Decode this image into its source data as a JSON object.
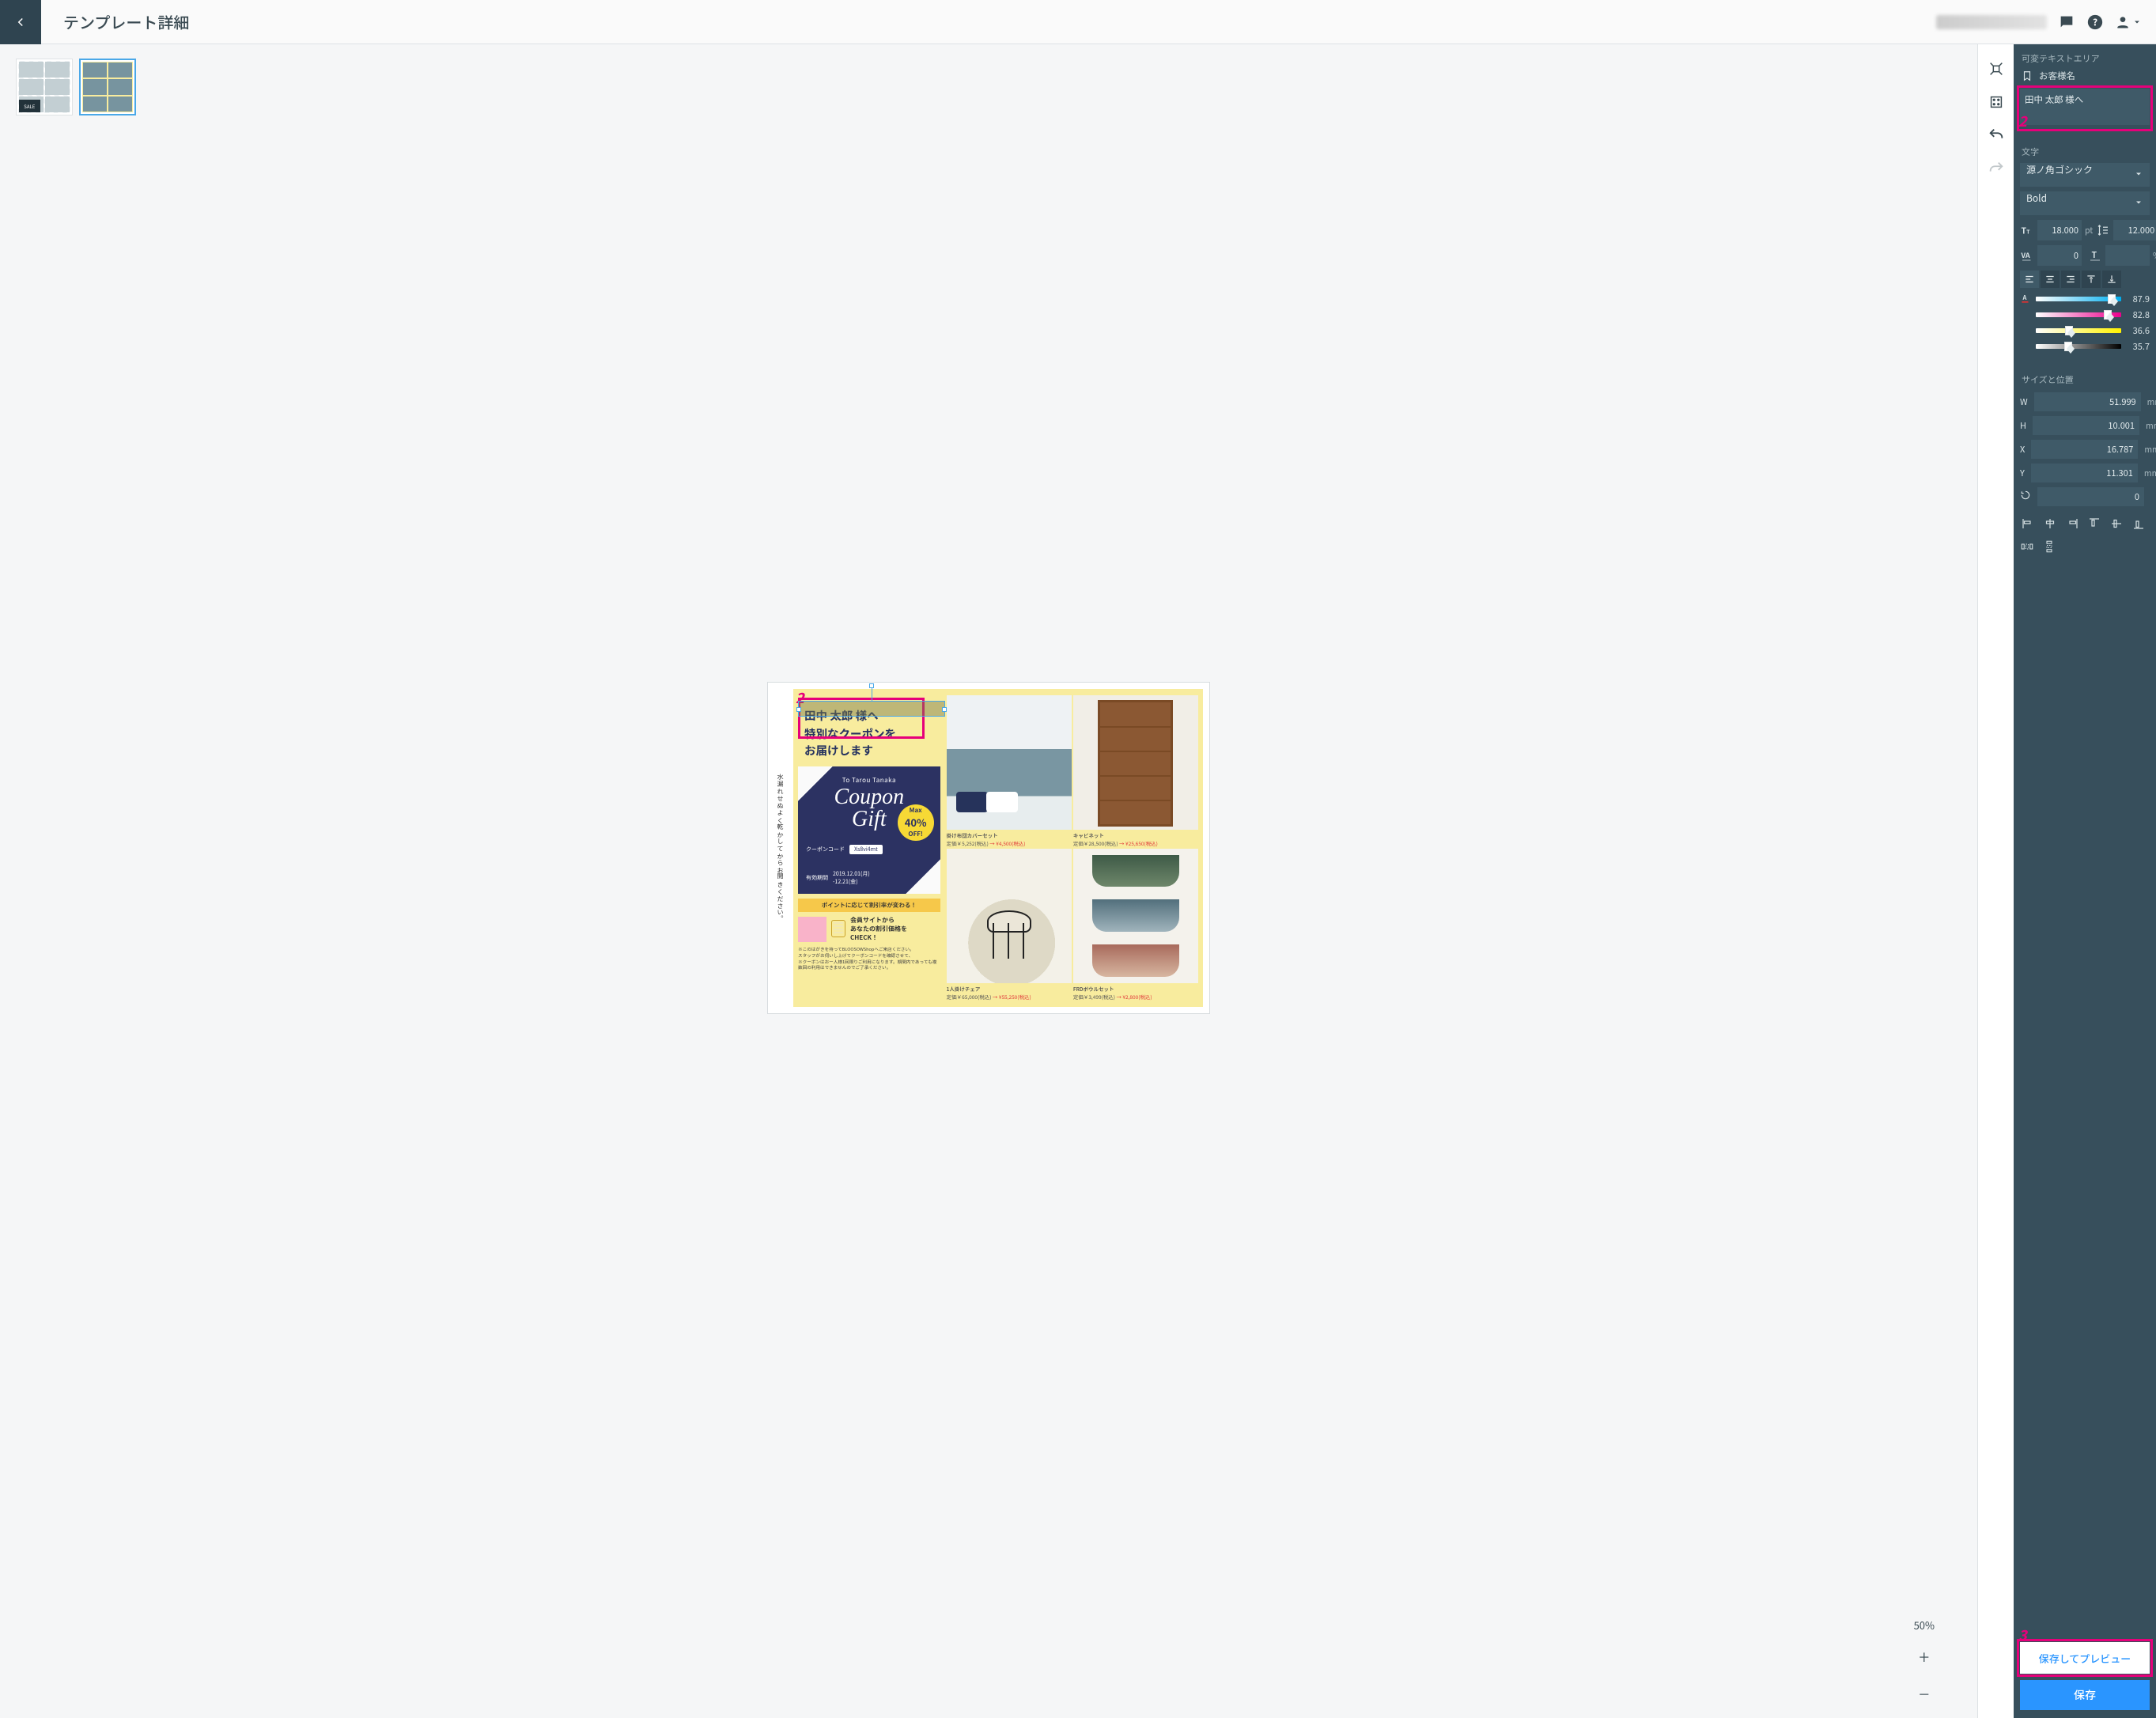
{
  "header": {
    "title": "テンプレート詳細"
  },
  "thumbs": {
    "sale_badge": "SALE"
  },
  "zoom": {
    "level": "50%"
  },
  "annotations": {
    "canvas_sel": "2",
    "panel_textarea": "2",
    "panel_preview": "3"
  },
  "canvas": {
    "vertical_note": "水漏れせぬよく乾かしてからお開きください。",
    "selected_text": "田中 太郎 様へ",
    "line2": "特別なクーポンを",
    "line3": "お届けします",
    "coupon": {
      "to": "To Tarou Tanaka",
      "big1": "Coupon",
      "big2": "Gift",
      "badge_top": "Max",
      "badge_pct": "40%",
      "badge_off": "OFF!",
      "code_label": "クーポンコード",
      "code": "Xs8vi4mt",
      "valid_label": "有効期間",
      "valid": "2019.12.01(月)\n-12.21(金)"
    },
    "point_bar": "ポイントに応じて割引率が変わる！",
    "check_site": "会員サイトから\nあなたの割引価格を\nCHECK！",
    "fineprint": "※このはがきを持ってBLOOSOWShopへご来店ください。\nスタッフがお伺いし上げてクーポンコードを確認させて、\n※クーポンはおー人様1回限りご利用になります。期間内であっても複数回の利用はできませんのでご了承ください。",
    "products": [
      {
        "name": "掛け布団カバーセット",
        "orig": "定価￥5,252(税込)",
        "price": "→ ¥4,500(税込)"
      },
      {
        "name": "キャビネット",
        "orig": "定価￥28,500(税込)",
        "price": "→ ¥25,650(税込)"
      },
      {
        "name": "1人掛けチェア",
        "orig": "定価￥65,000(税込)",
        "price": "→ ¥55,250(税込)"
      },
      {
        "name": "FRDボウルセット",
        "orig": "定価￥3,499(税込)",
        "price": "→ ¥2,800(税込)"
      }
    ]
  },
  "inspector": {
    "variable_text": {
      "section": "可変テキストエリア",
      "field_label": "お客様名",
      "value": "田中 太郎 様へ"
    },
    "text": {
      "section": "文字",
      "font": "源ノ角ゴシック",
      "weight": "Bold",
      "fontsize": "18.000",
      "fontsize_unit": "pt",
      "lineheight": "12.000",
      "lineheight_unit": "pt",
      "tracking": "0",
      "ratio": "",
      "ratio_unit": "%",
      "cmyk": {
        "c": "87.9",
        "m": "82.8",
        "y": "36.6",
        "k": "35.7"
      }
    },
    "size_pos": {
      "section": "サイズと位置",
      "w": "51.999",
      "h": "10.001",
      "x": "16.787",
      "y": "11.301",
      "r": "0",
      "unit": "mm"
    },
    "buttons": {
      "preview": "保存してプレビュー",
      "save": "保存"
    }
  }
}
